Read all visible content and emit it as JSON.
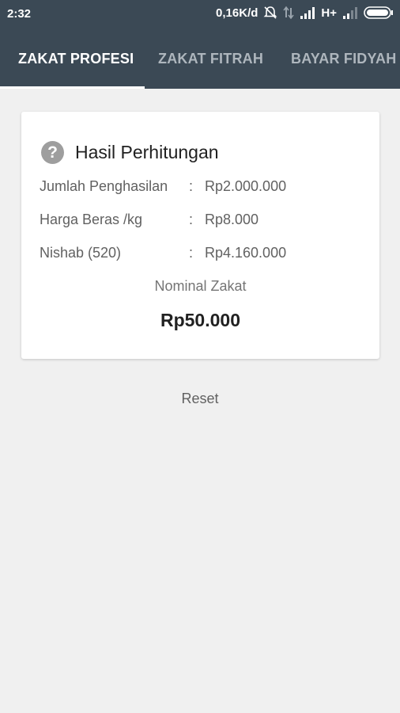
{
  "status_bar": {
    "time": "2:32",
    "network_speed": "0,16K/d",
    "network_type": "H+",
    "icons": [
      "alarm-off-icon",
      "data-arrows-icon",
      "signal-icon",
      "signal-weak-icon",
      "battery-icon"
    ]
  },
  "tabs": [
    {
      "label": "ZAKAT PROFESI",
      "active": true
    },
    {
      "label": "ZAKAT FITRAH",
      "active": false
    },
    {
      "label": "BAYAR FIDYAH",
      "active": false
    }
  ],
  "card": {
    "icon": "help-icon",
    "title": "Hasil Perhitungan",
    "rows": [
      {
        "label": "Jumlah Penghasilan",
        "value": "Rp2.000.000"
      },
      {
        "label": "Harga Beras /kg",
        "value": "Rp8.000"
      },
      {
        "label": "Nishab (520)",
        "value": "Rp4.160.000"
      }
    ],
    "separator": ":",
    "nominal_label": "Nominal Zakat",
    "nominal_value": "Rp50.000"
  },
  "reset_label": "Reset",
  "colors": {
    "app_bar": "#3b4955",
    "background": "#f0f0f0",
    "card": "#ffffff",
    "tab_inactive": "#aeb6bd"
  }
}
